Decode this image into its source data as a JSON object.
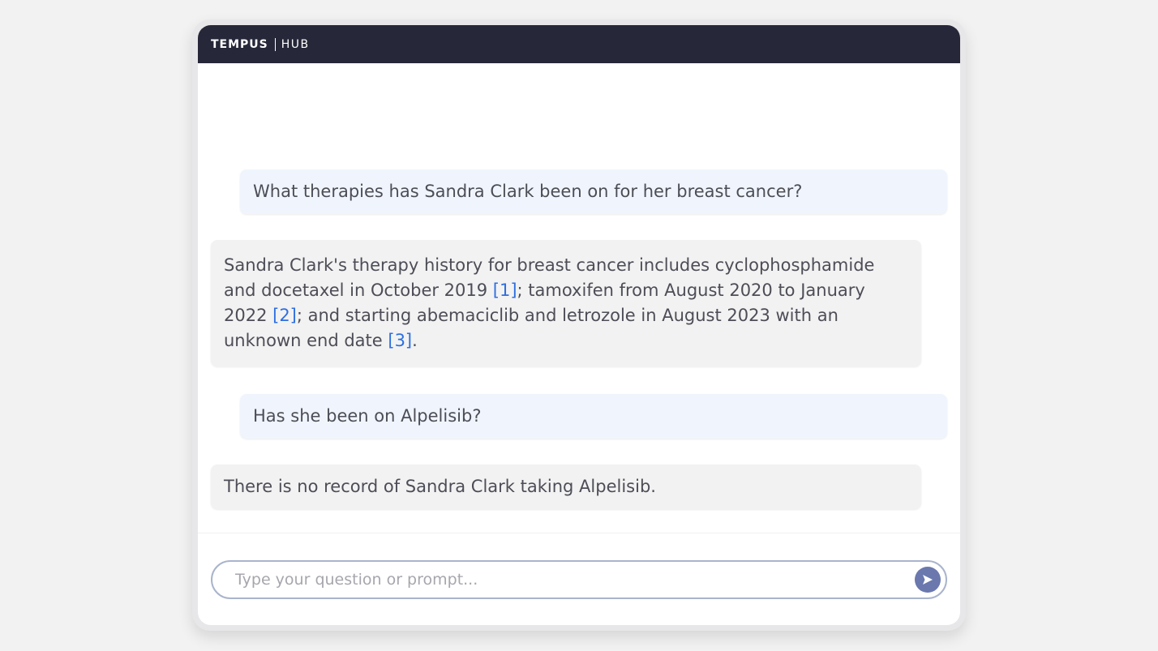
{
  "header": {
    "brand": "TEMPUS",
    "product": "HUB"
  },
  "messages": [
    {
      "role": "user",
      "text": "What therapies has Sandra Clark  been on for her breast cancer?"
    },
    {
      "role": "assistant",
      "parts": [
        "Sandra Clark's therapy history for breast cancer includes cyclophosphamide and docetaxel in October 2019 ",
        "[1]",
        "; tamoxifen from August 2020 to January 2022 ",
        "[2]",
        "; and starting abemaciclib and letrozole in August 2023 with an unknown end date ",
        "[3]",
        "."
      ]
    },
    {
      "role": "user",
      "text": "Has she been on Alpelisib?"
    },
    {
      "role": "assistant",
      "text": "There is no record of Sandra Clark taking Alpelisib."
    }
  ],
  "composer": {
    "placeholder": "Type your question or prompt...",
    "value": ""
  },
  "icons": {
    "send": "send-arrow-icon"
  },
  "colors": {
    "header_bg": "#262839",
    "citation": "#2e6fe0",
    "send_button": "#6a78ae",
    "user_bubble": "#f0f5fd",
    "assistant_bubble": "#f2f2f2"
  }
}
